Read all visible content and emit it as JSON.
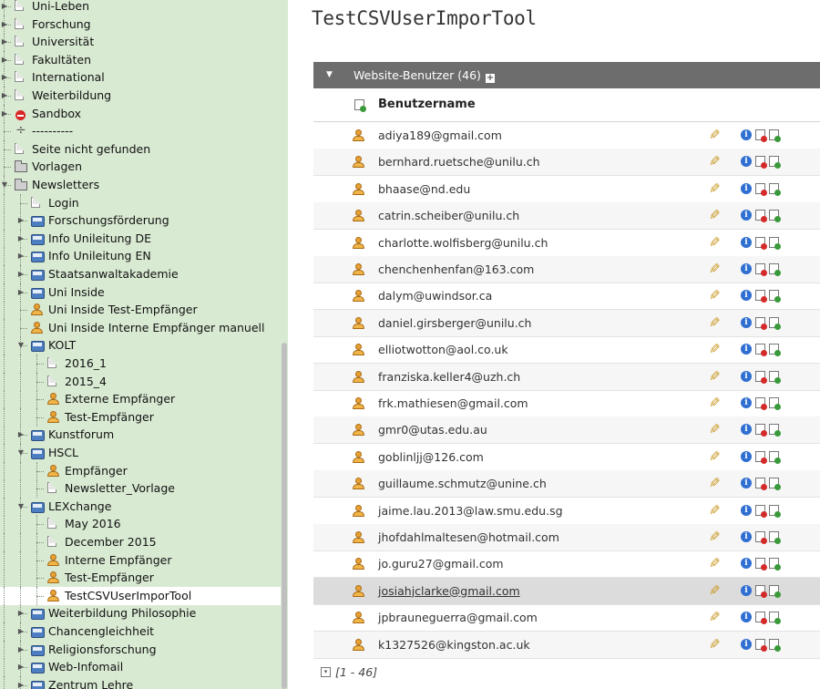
{
  "tree": {
    "items": [
      {
        "label": "Uni-Leben",
        "icon": "page-icon",
        "depth": 1,
        "toggle": true
      },
      {
        "label": "Forschung",
        "icon": "page-icon",
        "depth": 1,
        "toggle": true
      },
      {
        "label": "Universität",
        "icon": "page-icon",
        "depth": 1,
        "toggle": true
      },
      {
        "label": "Fakultäten",
        "icon": "page-icon",
        "depth": 1,
        "toggle": true
      },
      {
        "label": "International",
        "icon": "page-icon",
        "depth": 1,
        "toggle": true
      },
      {
        "label": "Weiterbildung",
        "icon": "page-icon",
        "depth": 1,
        "toggle": true
      },
      {
        "label": "Sandbox",
        "icon": "sandbox-icon",
        "depth": 1,
        "toggle": true
      },
      {
        "label": "----------",
        "icon": "spacer-icon",
        "depth": 1,
        "toggle": false
      },
      {
        "label": "Seite nicht gefunden",
        "icon": "page-icon",
        "depth": 1,
        "toggle": false
      },
      {
        "label": "Vorlagen",
        "icon": "folder-icon",
        "depth": 1,
        "toggle": false
      },
      {
        "label": "Newsletters",
        "icon": "folder-icon",
        "depth": 1,
        "toggle": true,
        "expanded": true
      },
      {
        "label": "Login",
        "icon": "page-icon",
        "depth": 2,
        "toggle": false
      },
      {
        "label": "Forschungsförderung",
        "icon": "newsletter-icon",
        "depth": 2,
        "toggle": true
      },
      {
        "label": "Info Unileitung DE",
        "icon": "newsletter-icon",
        "depth": 2,
        "toggle": true
      },
      {
        "label": "Info Unileitung EN",
        "icon": "newsletter-icon",
        "depth": 2,
        "toggle": true
      },
      {
        "label": "Staatsanwaltakademie",
        "icon": "newsletter-icon",
        "depth": 2,
        "toggle": true
      },
      {
        "label": "Uni Inside",
        "icon": "newsletter-icon",
        "depth": 2,
        "toggle": true
      },
      {
        "label": "Uni Inside Test-Empfänger",
        "icon": "user-icon",
        "depth": 2,
        "toggle": false
      },
      {
        "label": "Uni Inside Interne Empfänger manuell",
        "icon": "user-icon",
        "depth": 2,
        "toggle": false
      },
      {
        "label": "KOLT",
        "icon": "newsletter-icon",
        "depth": 2,
        "toggle": true,
        "expanded": true
      },
      {
        "label": "2016_1",
        "icon": "page-icon",
        "depth": 3,
        "toggle": false
      },
      {
        "label": "2015_4",
        "icon": "page-icon",
        "depth": 3,
        "toggle": false
      },
      {
        "label": "Externe Empfänger",
        "icon": "user-icon",
        "depth": 3,
        "toggle": false
      },
      {
        "label": "Test-Empfänger",
        "icon": "user-icon",
        "depth": 3,
        "toggle": false
      },
      {
        "label": "Kunstforum",
        "icon": "newsletter-icon",
        "depth": 2,
        "toggle": true
      },
      {
        "label": "HSCL",
        "icon": "newsletter-icon",
        "depth": 2,
        "toggle": true,
        "expanded": true
      },
      {
        "label": "Empfänger",
        "icon": "user-icon",
        "depth": 3,
        "toggle": false
      },
      {
        "label": "Newsletter_Vorlage",
        "icon": "page-icon",
        "depth": 3,
        "toggle": false
      },
      {
        "label": "LEXchange",
        "icon": "newsletter-icon",
        "depth": 2,
        "toggle": true,
        "expanded": true
      },
      {
        "label": "May 2016",
        "icon": "page-icon",
        "depth": 3,
        "toggle": false
      },
      {
        "label": "December 2015",
        "icon": "page-icon",
        "depth": 3,
        "toggle": false
      },
      {
        "label": "Interne Empfänger",
        "icon": "user-icon",
        "depth": 3,
        "toggle": false
      },
      {
        "label": "Test-Empfänger",
        "icon": "user-icon",
        "depth": 3,
        "toggle": false
      },
      {
        "label": "TestCSVUserImporTool",
        "icon": "user-icon",
        "depth": 3,
        "toggle": false,
        "selected": true
      },
      {
        "label": "Weiterbildung Philosophie",
        "icon": "newsletter-icon",
        "depth": 2,
        "toggle": true
      },
      {
        "label": "Chancengleichheit",
        "icon": "newsletter-icon",
        "depth": 2,
        "toggle": true
      },
      {
        "label": "Religionsforschung",
        "icon": "newsletter-icon",
        "depth": 2,
        "toggle": true
      },
      {
        "label": "Web-Infomail",
        "icon": "newsletter-icon",
        "depth": 2,
        "toggle": true
      },
      {
        "label": "Zentrum Lehre",
        "icon": "newsletter-icon",
        "depth": 2,
        "toggle": true
      }
    ]
  },
  "main": {
    "title": "TestCSVUserImporTool",
    "section": {
      "arrow": "▼",
      "title": "Website-Benutzer (46)",
      "add_symbol": "+"
    },
    "column_header": "Benutzername",
    "rows": [
      "adiya189@gmail.com",
      "bernhard.ruetsche@unilu.ch",
      "bhaase@nd.edu",
      "catrin.scheiber@unilu.ch",
      "charlotte.wolfisberg@unilu.ch",
      "chenchenhenfan@163.com",
      "dalym@uwindsor.ca",
      "daniel.girsberger@unilu.ch",
      "elliotwotton@aol.co.uk",
      "franziska.keller4@uzh.ch",
      "frk.mathiesen@gmail.com",
      "gmr0@utas.edu.au",
      "goblinljj@126.com",
      "guillaume.schmutz@unine.ch",
      "jaime.lau.2013@law.smu.edu.sg",
      "jhofdahlmaltesen@hotmail.com",
      "jo.guru27@gmail.com",
      "josiahjclarke@gmail.com",
      "jpbrauneguerra@gmail.com",
      "k1327526@kingston.ac.uk"
    ],
    "highlighted_row": 17,
    "info_symbol": "i",
    "pager": "[1 - 46]"
  }
}
